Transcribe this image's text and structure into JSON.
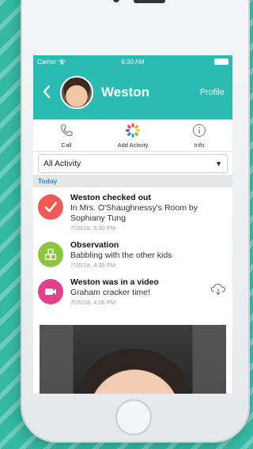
{
  "status": {
    "carrier": "Carrier",
    "time": "6:30 AM"
  },
  "header": {
    "title": "Weston",
    "profile_label": "Profile",
    "back_icon": "chevron-left-icon"
  },
  "actions": [
    {
      "label": "Call",
      "icon": "phone-icon"
    },
    {
      "label": "Add Activity",
      "icon": "add-activity-icon"
    },
    {
      "label": "Info",
      "icon": "info-icon"
    }
  ],
  "filter": {
    "selected": "All Activity"
  },
  "section_title": "Today",
  "feed": [
    {
      "title": "Weston checked out",
      "description": "In Mrs. O'Shaughnessy's Room by Sophiany Tung",
      "time": "7/20/18, 5:30 PM",
      "icon": "checkmark-icon",
      "color": "#ef5a56"
    },
    {
      "title": "Observation",
      "description": "Babbling with the other kids",
      "time": "7/20/18, 4:35 PM",
      "icon": "blocks-icon",
      "color": "#8bc53f"
    },
    {
      "title": "Weston was in a video",
      "description": "Graham cracker time!",
      "time": "7/20/18, 4:06 PM",
      "icon": "video-camera-icon",
      "color": "#e23f8c"
    }
  ],
  "colors": {
    "accent": "#2abcb2",
    "background": "#35b9a4",
    "section_link": "#2a8ac8"
  }
}
